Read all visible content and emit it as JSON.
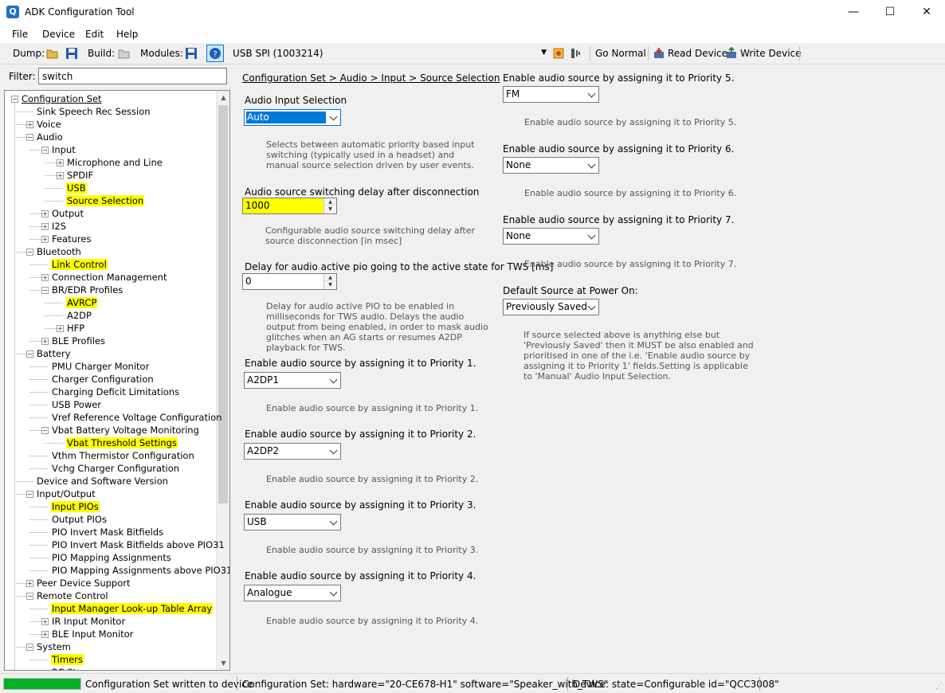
{
  "window": {
    "title": "ADK Configuration Tool",
    "minimize": "—",
    "maximize": "☐",
    "close": "✕"
  },
  "menu": [
    "File",
    "Device",
    "Edit",
    "Help"
  ],
  "toolbar": {
    "dump_label": "Dump:",
    "build_label": "Build:",
    "modules_label": "Modules:",
    "device_combo": "USB SPI (1003214)",
    "go_normal": "Go Normal",
    "read_device": "Read Device",
    "write_device": "Write Device"
  },
  "filter": {
    "label": "Filter:",
    "value": "switch"
  },
  "tree": {
    "root": "Configuration Set",
    "items": [
      {
        "label": "Sink Speech Rec Session",
        "level": 1,
        "expander": "",
        "highlight": false
      },
      {
        "label": "Voice",
        "level": 1,
        "expander": "+",
        "highlight": false
      },
      {
        "label": "Audio",
        "level": 1,
        "expander": "−",
        "highlight": false
      },
      {
        "label": "Input",
        "level": 2,
        "expander": "−",
        "highlight": false
      },
      {
        "label": "Microphone and Line",
        "level": 3,
        "expander": "+",
        "highlight": false
      },
      {
        "label": "SPDIF",
        "level": 3,
        "expander": "+",
        "highlight": false
      },
      {
        "label": "USB",
        "level": 3,
        "expander": "",
        "highlight": true
      },
      {
        "label": "Source Selection",
        "level": 3,
        "expander": "",
        "highlight": true
      },
      {
        "label": "Output",
        "level": 2,
        "expander": "+",
        "highlight": false
      },
      {
        "label": "I2S",
        "level": 2,
        "expander": "+",
        "highlight": false
      },
      {
        "label": "Features",
        "level": 2,
        "expander": "+",
        "highlight": false
      },
      {
        "label": "Bluetooth",
        "level": 1,
        "expander": "−",
        "highlight": false
      },
      {
        "label": "Link Control",
        "level": 2,
        "expander": "",
        "highlight": true
      },
      {
        "label": "Connection Management",
        "level": 2,
        "expander": "+",
        "highlight": false
      },
      {
        "label": "BR/EDR Profiles",
        "level": 2,
        "expander": "−",
        "highlight": false
      },
      {
        "label": "AVRCP",
        "level": 3,
        "expander": "",
        "highlight": true
      },
      {
        "label": "A2DP",
        "level": 3,
        "expander": "",
        "highlight": false
      },
      {
        "label": "HFP",
        "level": 3,
        "expander": "+",
        "highlight": false
      },
      {
        "label": "BLE Profiles",
        "level": 2,
        "expander": "+",
        "highlight": false
      },
      {
        "label": "Battery",
        "level": 1,
        "expander": "−",
        "highlight": false
      },
      {
        "label": "PMU Charger Monitor",
        "level": 2,
        "expander": "",
        "highlight": false
      },
      {
        "label": "Charger Configuration",
        "level": 2,
        "expander": "",
        "highlight": false
      },
      {
        "label": "Charging Deficit Limitations",
        "level": 2,
        "expander": "",
        "highlight": false
      },
      {
        "label": "USB Power",
        "level": 2,
        "expander": "",
        "highlight": false
      },
      {
        "label": "Vref Reference Voltage Configuration",
        "level": 2,
        "expander": "",
        "highlight": false
      },
      {
        "label": "Vbat Battery Voltage Monitoring",
        "level": 2,
        "expander": "−",
        "highlight": false
      },
      {
        "label": "Vbat Threshold Settings",
        "level": 3,
        "expander": "",
        "highlight": true
      },
      {
        "label": "Vthm Thermistor Configuration",
        "level": 2,
        "expander": "",
        "highlight": false
      },
      {
        "label": "Vchg Charger Configuration",
        "level": 2,
        "expander": "",
        "highlight": false
      },
      {
        "label": "Device and Software Version",
        "level": 1,
        "expander": "",
        "highlight": false
      },
      {
        "label": "Input/Output",
        "level": 1,
        "expander": "−",
        "highlight": false
      },
      {
        "label": "Input PIOs",
        "level": 2,
        "expander": "",
        "highlight": true
      },
      {
        "label": "Output PIOs",
        "level": 2,
        "expander": "",
        "highlight": false
      },
      {
        "label": "PIO Invert Mask Bitfields",
        "level": 2,
        "expander": "",
        "highlight": false
      },
      {
        "label": "PIO Invert Mask Bitfields above PIO31",
        "level": 2,
        "expander": "",
        "highlight": false
      },
      {
        "label": "PIO Mapping Assignments",
        "level": 2,
        "expander": "",
        "highlight": false
      },
      {
        "label": "PIO Mapping Assignments above PIO31",
        "level": 2,
        "expander": "",
        "highlight": false
      },
      {
        "label": "Peer Device Support",
        "level": 1,
        "expander": "+",
        "highlight": false
      },
      {
        "label": "Remote Control",
        "level": 1,
        "expander": "−",
        "highlight": false
      },
      {
        "label": "Input Manager Look-up Table Array",
        "level": 2,
        "expander": "",
        "highlight": true
      },
      {
        "label": "IR Input Monitor",
        "level": 2,
        "expander": "+",
        "highlight": false
      },
      {
        "label": "BLE Input Monitor",
        "level": 2,
        "expander": "+",
        "highlight": false
      },
      {
        "label": "System",
        "level": 1,
        "expander": "−",
        "highlight": false
      },
      {
        "label": "Timers",
        "level": 2,
        "expander": "",
        "highlight": true
      },
      {
        "label": "RC St",
        "level": 2,
        "expander": "",
        "highlight": false
      }
    ]
  },
  "content": {
    "breadcrumb": "Configuration Set > Audio > Input > Source Selection",
    "audio_input_selection": {
      "label": "Audio Input Selection",
      "value": "Auto",
      "desc": "Selects between automatic priority based input switching (typically used in a headset) and manual source selection driven by user events."
    },
    "switching_delay": {
      "label": "Audio source switching delay after disconnection",
      "value": "1000",
      "desc": "Configurable audio source switching delay after source disconnection [in msec]"
    },
    "tws_delay": {
      "label": "Delay for audio active pio going to the active state for TWS [ms]",
      "value": "0",
      "desc": "Delay for audio active PIO to be enabled in milliseconds for TWS audio. Delays the audio output from being enabled, in order to mask audio glitches when an AG starts or resumes A2DP playback for TWS."
    },
    "priorities": [
      {
        "label": "Enable audio source by assigning it to Priority 1.",
        "value": "A2DP1",
        "desc": "Enable audio source by assigning it to Priority 1."
      },
      {
        "label": "Enable audio source by assigning it to Priority 2.",
        "value": "A2DP2",
        "desc": "Enable audio source by assigning it to Priority 2."
      },
      {
        "label": "Enable audio source by assigning it to Priority 3.",
        "value": "USB",
        "desc": "Enable audio source by assigning it to Priority 3."
      },
      {
        "label": "Enable audio source by assigning it to Priority 4.",
        "value": "Analogue",
        "desc": "Enable audio source by assigning it to Priority 4."
      },
      {
        "label": "Enable audio source by assigning it to Priority 5.",
        "value": "FM",
        "desc": "Enable audio source by assigning it to Priority 5."
      },
      {
        "label": "Enable audio source by assigning it to Priority 6.",
        "value": "None",
        "desc": "Enable audio source by assigning it to Priority 6."
      },
      {
        "label": "Enable audio source by assigning it to Priority 7.",
        "value": "None",
        "desc": "Enable audio source by assigning it to Priority 7."
      }
    ],
    "default_source": {
      "label": "Default Source at Power On:",
      "value": "Previously Saved",
      "desc": "If source selected above is anything else but 'Previously Saved' then it MUST be also enabled and prioritised in one of the i.e. 'Enable audio source by assigning it to Priority 1' fields.Setting is applicable to 'Manual' Audio Input Selection."
    }
  },
  "status": {
    "progress_fraction": 1.0,
    "message": "Configuration Set written to device",
    "config_set": "Configuration Set:  hardware=\"20-CE678-H1\" software=\"Speaker_with_TWS\"",
    "device": "Device:  state=Configurable id=\"QCC3008\""
  },
  "colors": {
    "highlight": "#ffff00",
    "selection": "#0078d7",
    "progress": "#06b025"
  }
}
